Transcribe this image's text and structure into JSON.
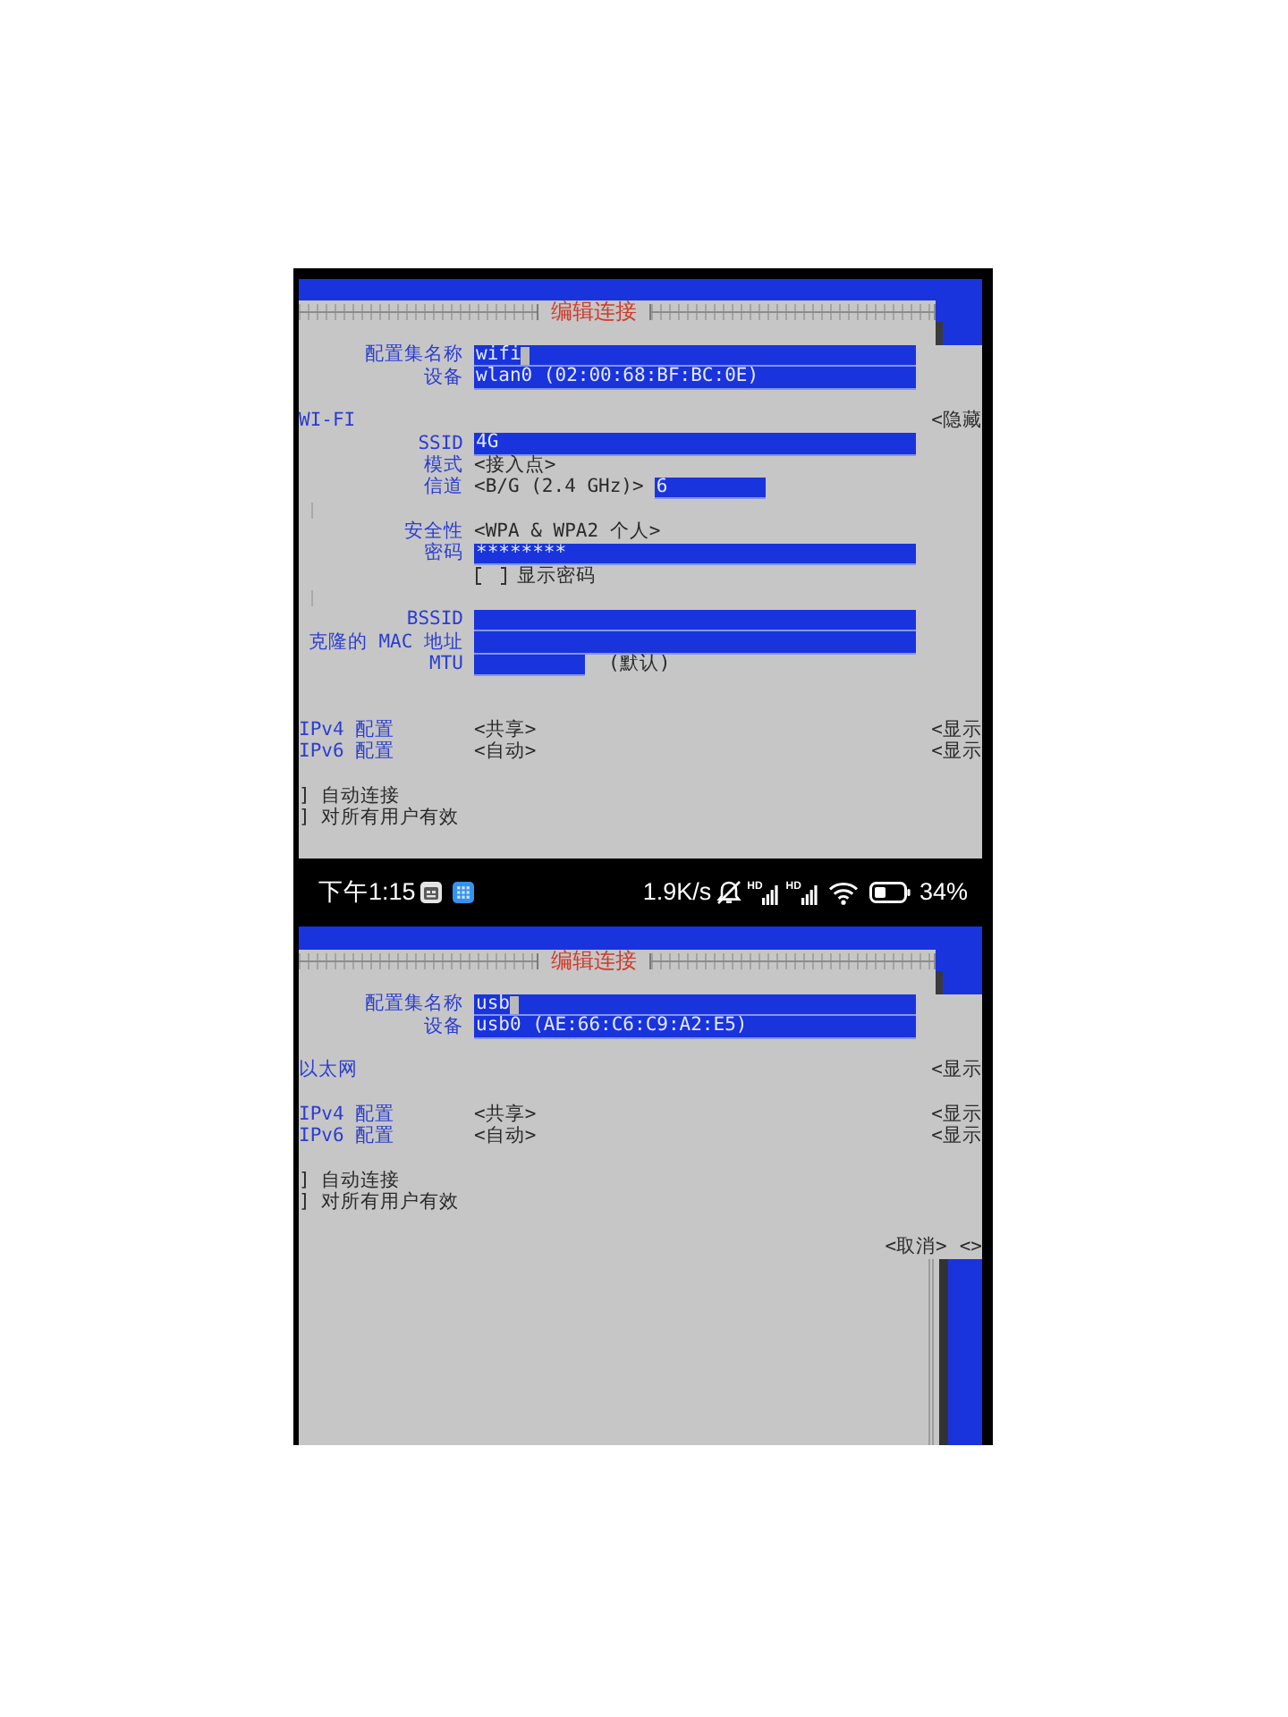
{
  "top_screen": {
    "dialog_title": "编辑连接",
    "blocks": [
      {
        "rows": [
          {
            "kind": "labeled",
            "label": "配置集名称",
            "parts": [
              {
                "kind": "field",
                "value": "wifi",
                "focused": true
              }
            ]
          },
          {
            "kind": "labeled",
            "label": "设备",
            "parts": [
              {
                "kind": "field",
                "value": "wlan0 (02:00:68:BF:BC:0E)",
                "focused": false
              }
            ]
          }
        ]
      },
      {
        "rows": [
          {
            "kind": "section",
            "label": "WI-FI",
            "toggle": "<隐藏",
            "groups": [
              [
                {
                  "kind": "labeled",
                  "label": "SSID",
                  "parts": [
                    {
                      "kind": "field",
                      "value": "4G",
                      "focused": false
                    }
                  ]
                },
                {
                  "kind": "labeled",
                  "label": "模式",
                  "parts": [
                    {
                      "kind": "choice",
                      "text": "<接入点>"
                    }
                  ]
                },
                {
                  "kind": "labeled",
                  "label": "信道",
                  "parts": [
                    {
                      "kind": "choice",
                      "text": "<B/G (2.4 GHz)>"
                    },
                    {
                      "kind": "short_field",
                      "value": "6",
                      "focused": false
                    }
                  ]
                }
              ],
              [
                {
                  "kind": "labeled",
                  "label": "安全性",
                  "parts": [
                    {
                      "kind": "choice",
                      "text": "<WPA & WPA2 个人>"
                    }
                  ]
                },
                {
                  "kind": "labeled",
                  "label": "密码",
                  "parts": [
                    {
                      "kind": "field",
                      "value": "********",
                      "focused": false
                    }
                  ]
                },
                {
                  "kind": "labeled",
                  "parts": [
                    {
                      "kind": "checkbox",
                      "checked": false,
                      "text": "显示密码"
                    }
                  ]
                }
              ],
              [
                {
                  "kind": "labeled",
                  "label": "BSSID",
                  "parts": [
                    {
                      "kind": "field",
                      "focused": false
                    }
                  ]
                },
                {
                  "kind": "labeled",
                  "label": "克隆的 MAC 地址",
                  "parts": [
                    {
                      "kind": "field",
                      "focused": false
                    }
                  ]
                },
                {
                  "kind": "labeled",
                  "label": "MTU",
                  "parts": [
                    {
                      "kind": "short_field",
                      "focused": false
                    },
                    {
                      "kind": "note",
                      "text": "(默认)"
                    }
                  ]
                }
              ]
            ]
          }
        ]
      },
      {
        "rows": [
          {
            "kind": "section",
            "label": "IPv4 配置",
            "value": "<共享>",
            "toggle": "<显示"
          },
          {
            "kind": "section",
            "label": "IPv6 配置",
            "value": "<自动>",
            "toggle": "<显示"
          }
        ]
      },
      {
        "rows": [
          {
            "kind": "text",
            "text": "] 自动连接"
          },
          {
            "kind": "text",
            "text": "] 对所有用户有效"
          }
        ]
      }
    ]
  },
  "status_bar": {
    "time": "下午1:15",
    "speed": "1.9K/s",
    "signal_badges": [
      "HD",
      "HD"
    ],
    "battery": "34%"
  },
  "bottom_screen": {
    "dialog_title": "编辑连接",
    "blocks": [
      {
        "rows": [
          {
            "kind": "labeled",
            "label": "配置集名称",
            "parts": [
              {
                "kind": "field",
                "value": "usb",
                "focused": true
              }
            ]
          },
          {
            "kind": "labeled",
            "label": "设备",
            "parts": [
              {
                "kind": "field",
                "value": "usb0 (AE:66:C6:C9:A2:E5)",
                "focused": false
              }
            ]
          }
        ]
      },
      {
        "rows": [
          {
            "kind": "section",
            "label": "以太网",
            "toggle": "<显示"
          }
        ]
      },
      {
        "rows": [
          {
            "kind": "section",
            "label": "IPv4 配置",
            "value": "<共享>",
            "toggle": "<显示"
          },
          {
            "kind": "section",
            "label": "IPv6 配置",
            "value": "<自动>",
            "toggle": "<显示"
          }
        ]
      },
      {
        "rows": [
          {
            "kind": "text",
            "text": "] 自动连接"
          },
          {
            "kind": "text",
            "text": "] 对所有用户有效"
          }
        ]
      },
      {
        "rows": [
          {
            "kind": "buttons",
            "buttons": [
              "<取消>",
              "<>"
            ]
          }
        ]
      }
    ]
  }
}
